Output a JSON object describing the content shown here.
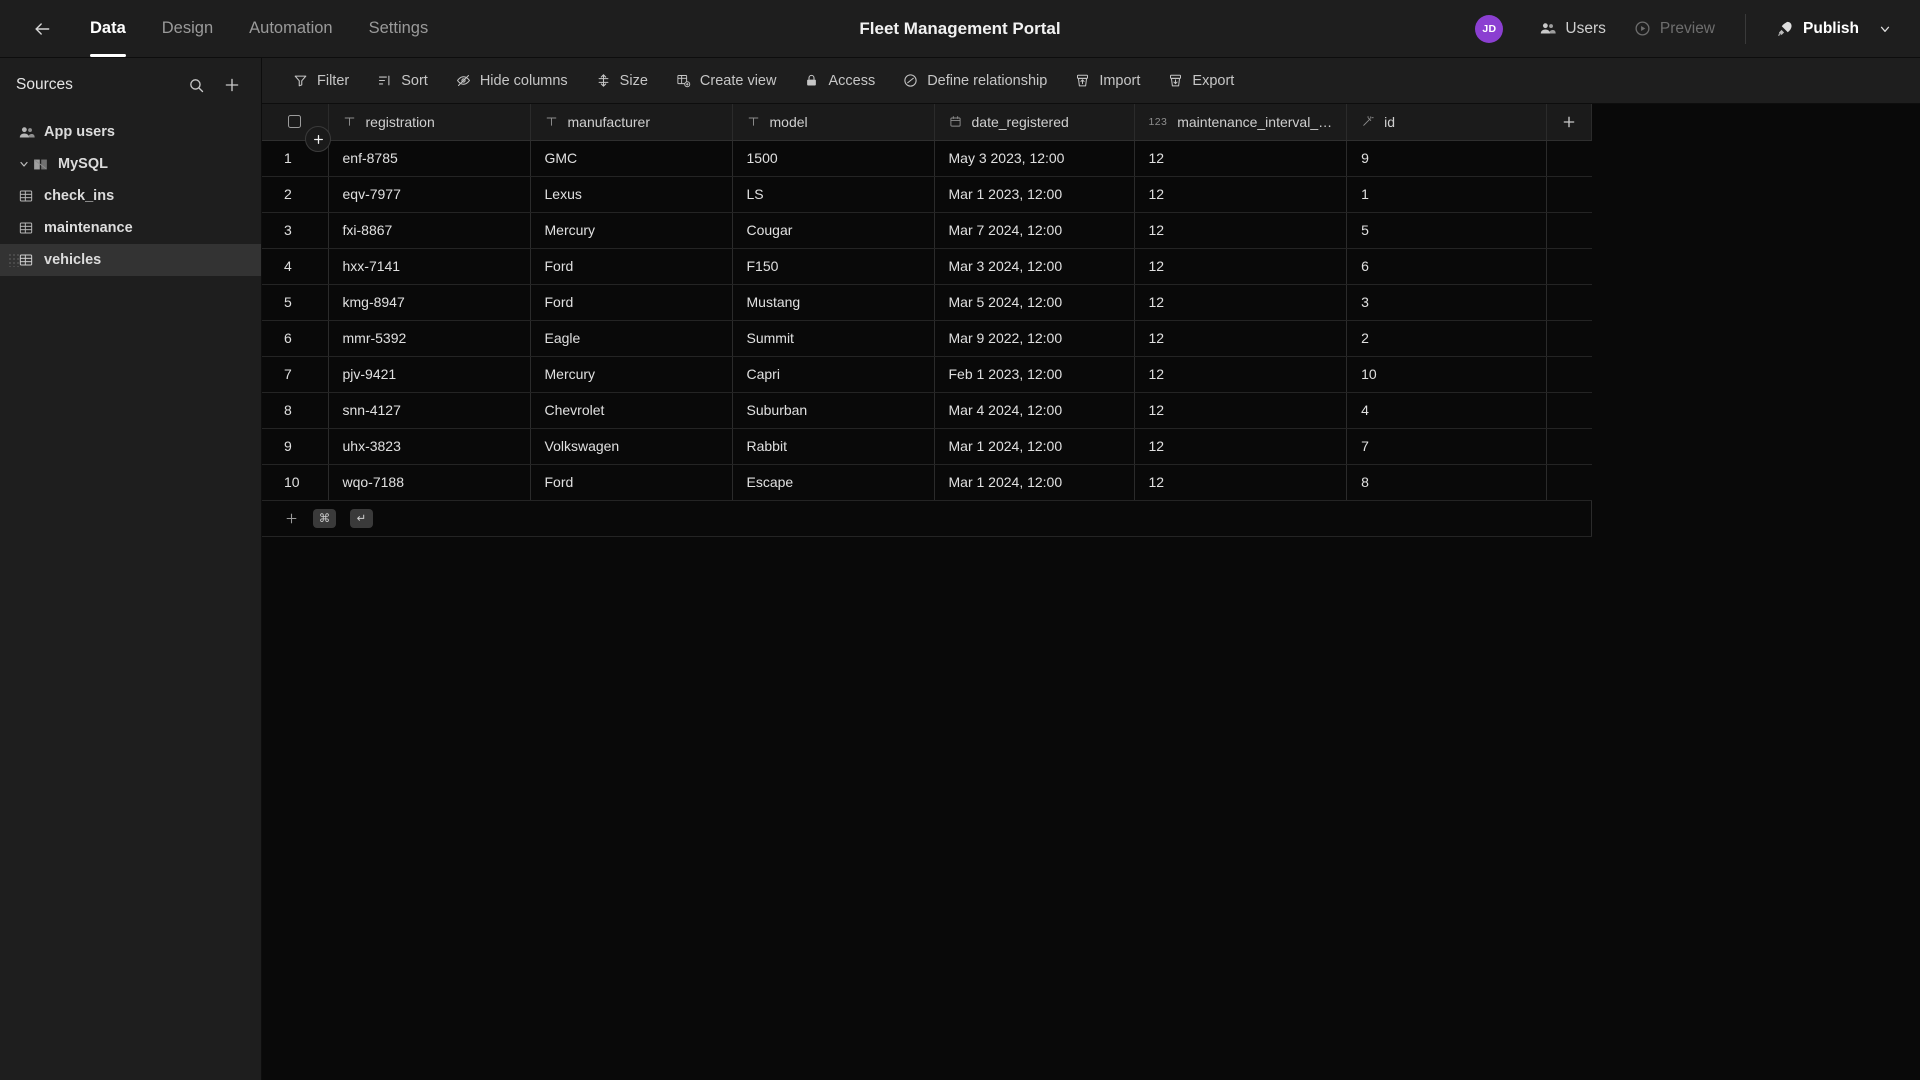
{
  "header": {
    "back_icon": "arrow-left-icon",
    "title": "Fleet Management Portal",
    "tabs": [
      {
        "label": "Data",
        "active": true
      },
      {
        "label": "Design",
        "active": false
      },
      {
        "label": "Automation",
        "active": false
      },
      {
        "label": "Settings",
        "active": false
      }
    ],
    "avatar_initials": "JD",
    "avatar_color": "#8b3fd1",
    "users_label": "Users",
    "preview_label": "Preview",
    "publish_label": "Publish"
  },
  "sidebar": {
    "title": "Sources",
    "search_icon": "search-icon",
    "add_icon": "plus-icon",
    "items": [
      {
        "label": "App users",
        "icon": "users-icon",
        "type": "root",
        "selected": false
      },
      {
        "label": "MySQL",
        "icon": "database-icon",
        "type": "group",
        "selected": false,
        "expanded": true
      },
      {
        "label": "check_ins",
        "icon": "table-icon",
        "type": "table",
        "selected": false
      },
      {
        "label": "maintenance",
        "icon": "table-icon",
        "type": "table",
        "selected": false
      },
      {
        "label": "vehicles",
        "icon": "table-icon",
        "type": "table",
        "selected": true
      }
    ]
  },
  "toolbar": {
    "items": [
      {
        "label": "Filter",
        "icon": "filter-icon"
      },
      {
        "label": "Sort",
        "icon": "sort-icon"
      },
      {
        "label": "Hide columns",
        "icon": "eye-off-icon"
      },
      {
        "label": "Size",
        "icon": "row-height-icon"
      },
      {
        "label": "Create view",
        "icon": "grid-add-icon"
      },
      {
        "label": "Access",
        "icon": "lock-icon"
      },
      {
        "label": "Define relationship",
        "icon": "relationship-icon"
      },
      {
        "label": "Import",
        "icon": "import-icon"
      },
      {
        "label": "Export",
        "icon": "export-icon"
      }
    ]
  },
  "grid": {
    "columns": [
      {
        "name": "registration",
        "type_icon": "text-type-icon",
        "align": "left"
      },
      {
        "name": "manufacturer",
        "type_icon": "text-type-icon",
        "align": "left"
      },
      {
        "name": "model",
        "type_icon": "text-type-icon",
        "align": "left"
      },
      {
        "name": "date_registered",
        "type_icon": "date-type-icon",
        "align": "left"
      },
      {
        "name": "maintenance_interval_…",
        "type_icon": "number-type-icon",
        "align": "right"
      },
      {
        "name": "id",
        "type_icon": "magic-type-icon",
        "align": "right"
      }
    ],
    "add_column_icon": "plus-icon",
    "rows": [
      {
        "n": "1",
        "registration": "enf-8785",
        "manufacturer": "GMC",
        "model": "1500",
        "date_registered": "May 3 2023, 12:00",
        "maintenance_interval": "12",
        "id": "9"
      },
      {
        "n": "2",
        "registration": "eqv-7977",
        "manufacturer": "Lexus",
        "model": "LS",
        "date_registered": "Mar 1 2023, 12:00",
        "maintenance_interval": "12",
        "id": "1"
      },
      {
        "n": "3",
        "registration": "fxi-8867",
        "manufacturer": "Mercury",
        "model": "Cougar",
        "date_registered": "Mar 7 2024, 12:00",
        "maintenance_interval": "12",
        "id": "5"
      },
      {
        "n": "4",
        "registration": "hxx-7141",
        "manufacturer": "Ford",
        "model": "F150",
        "date_registered": "Mar 3 2024, 12:00",
        "maintenance_interval": "12",
        "id": "6"
      },
      {
        "n": "5",
        "registration": "kmg-8947",
        "manufacturer": "Ford",
        "model": "Mustang",
        "date_registered": "Mar 5 2024, 12:00",
        "maintenance_interval": "12",
        "id": "3"
      },
      {
        "n": "6",
        "registration": "mmr-5392",
        "manufacturer": "Eagle",
        "model": "Summit",
        "date_registered": "Mar 9 2022, 12:00",
        "maintenance_interval": "12",
        "id": "2"
      },
      {
        "n": "7",
        "registration": "pjv-9421",
        "manufacturer": "Mercury",
        "model": "Capri",
        "date_registered": "Feb 1 2023, 12:00",
        "maintenance_interval": "12",
        "id": "10"
      },
      {
        "n": "8",
        "registration": "snn-4127",
        "manufacturer": "Chevrolet",
        "model": "Suburban",
        "date_registered": "Mar 4 2024, 12:00",
        "maintenance_interval": "12",
        "id": "4"
      },
      {
        "n": "9",
        "registration": "uhx-3823",
        "manufacturer": "Volkswagen",
        "model": "Rabbit",
        "date_registered": "Mar 1 2024, 12:00",
        "maintenance_interval": "12",
        "id": "7"
      },
      {
        "n": "10",
        "registration": "wqo-7188",
        "manufacturer": "Ford",
        "model": "Escape",
        "date_registered": "Mar 1 2024, 12:00",
        "maintenance_interval": "12",
        "id": "8"
      }
    ],
    "add_row": {
      "plus_icon": "plus-icon",
      "shortcut_cmd": "⌘",
      "shortcut_enter": "↵"
    }
  }
}
